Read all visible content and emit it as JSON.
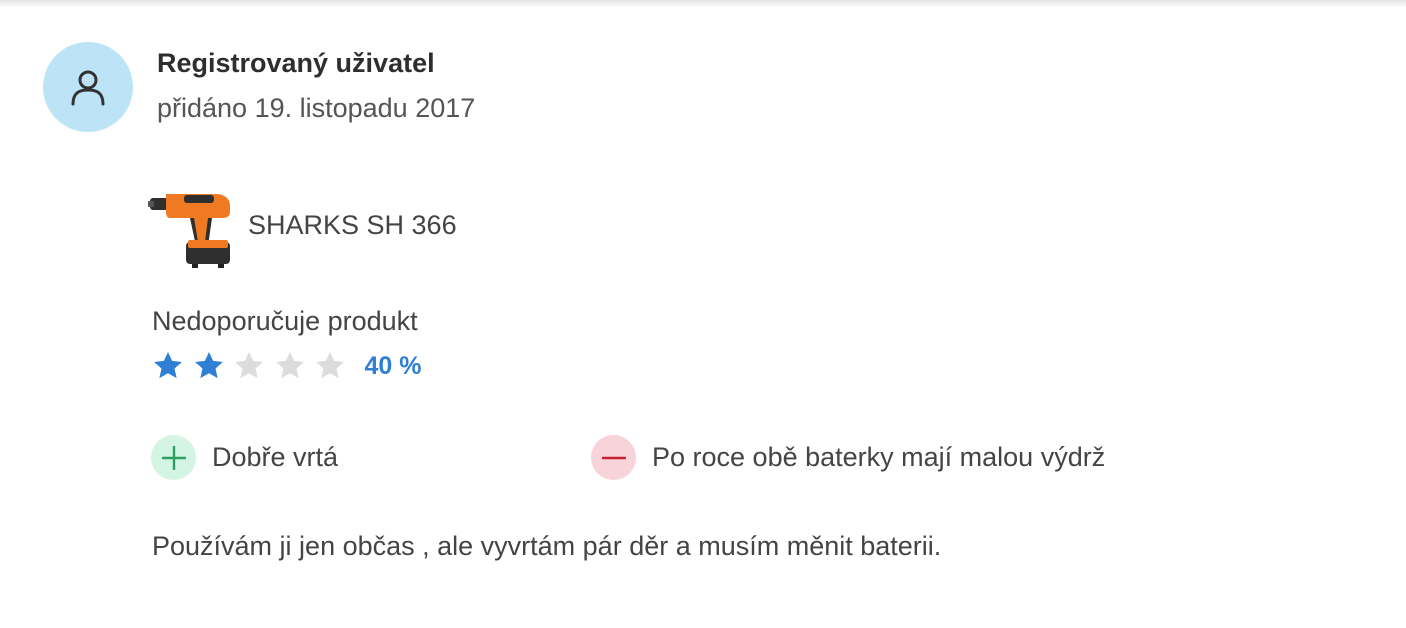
{
  "review": {
    "author": "Registrovaný uživatel",
    "added": "přidáno 19. listopadu 2017",
    "avatar_icon": "user-icon",
    "product": {
      "name": "SHARKS SH 366",
      "image_icon": "cordless-drill-image"
    },
    "recommendation": "Nedoporučuje produkt",
    "rating": {
      "stars_filled": 2,
      "stars_total": 5,
      "percent_label": "40 %",
      "filled_color": "#2f7fd6",
      "empty_color": "#dcdcdc"
    },
    "pros": [
      {
        "text": "Dobře vrtá",
        "icon": "plus-icon"
      }
    ],
    "cons": [
      {
        "text": "Po roce obě baterky mají malou výdrž",
        "icon": "minus-icon"
      }
    ],
    "text": "Používám ji jen občas , ale vyvrtám pár děr a musím měnit baterii."
  },
  "colors": {
    "avatar_bg": "#bde3f7",
    "pro_bg": "#d4f5e3",
    "pro_icon": "#2e9e62",
    "con_bg": "#f8d3da",
    "con_icon": "#c4232f"
  }
}
